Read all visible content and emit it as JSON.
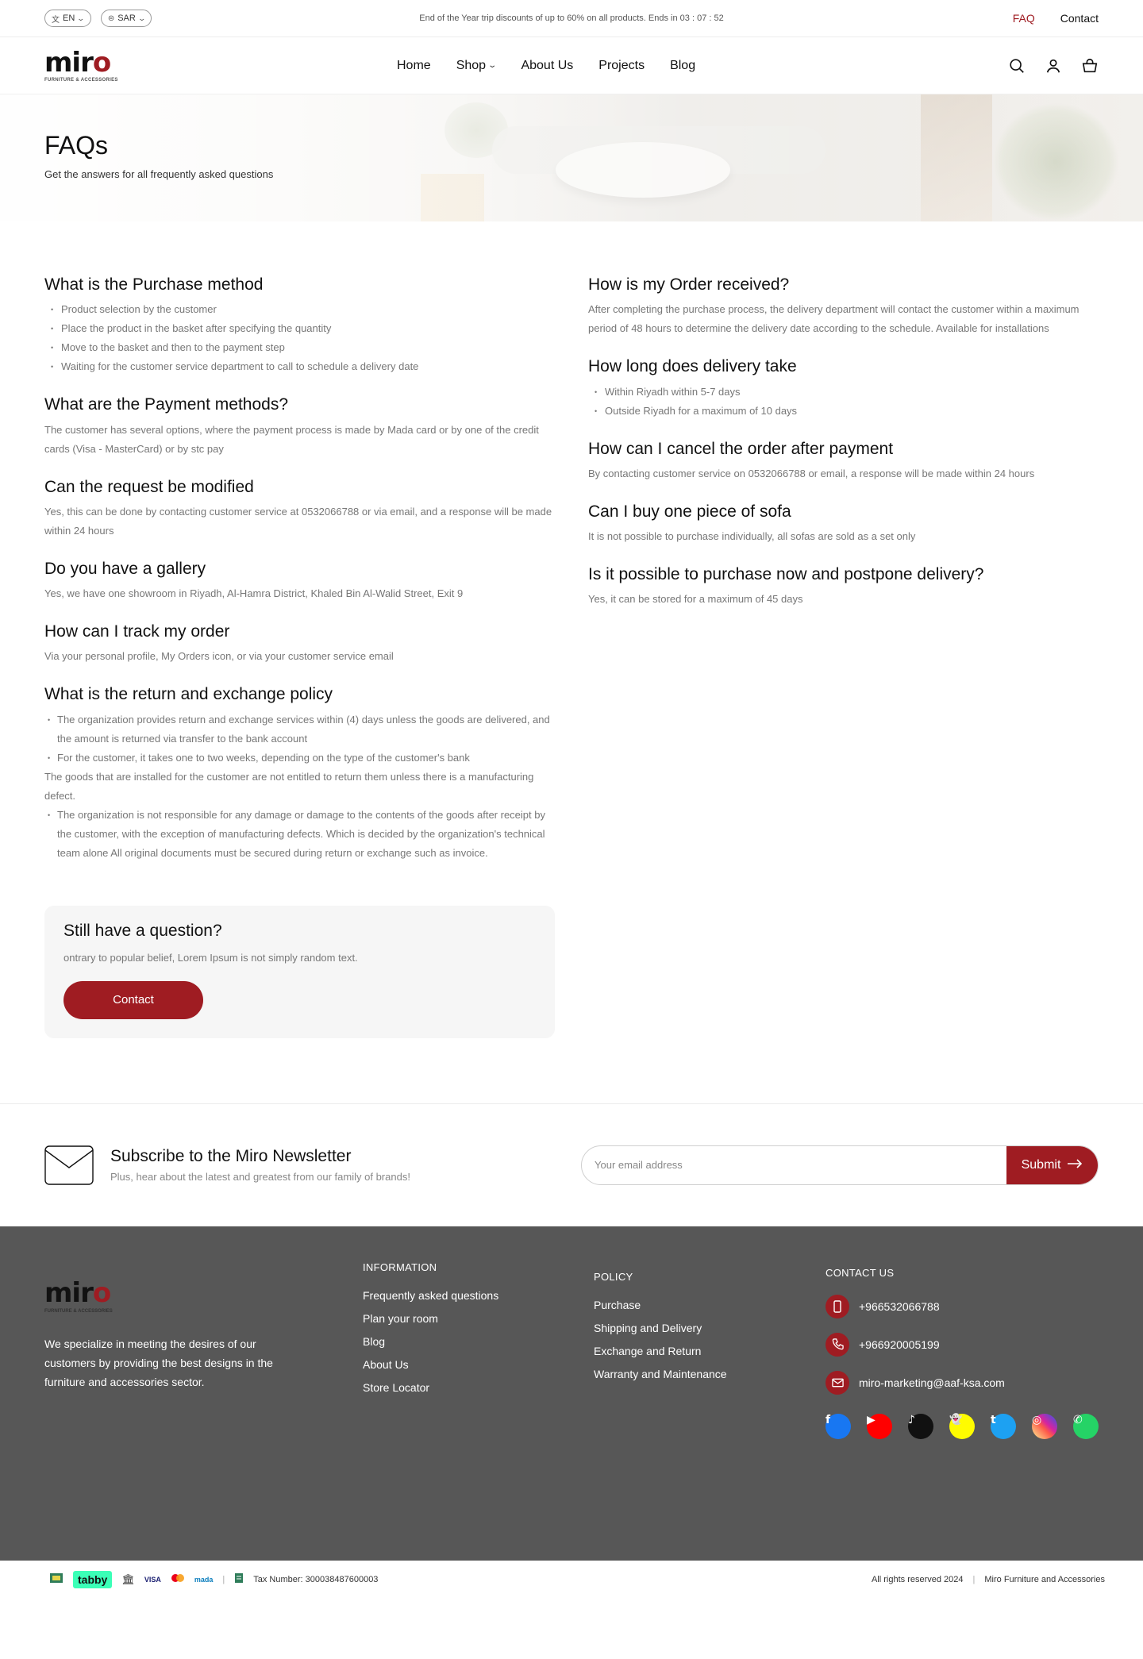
{
  "topbar": {
    "lang": "EN",
    "currency": "SAR",
    "promo": "End of the Year trip discounts of up to 60% on all products. Ends in 03 : 07 : 52",
    "links": {
      "faq": "FAQ",
      "contact": "Contact"
    }
  },
  "header": {
    "logo_word_main": "mir",
    "logo_word_accent": "o",
    "logo_tagline": "FURNITURE & ACCESSORIES",
    "nav": [
      "Home",
      "Shop",
      "About Us",
      "Projects",
      "Blog"
    ]
  },
  "hero": {
    "title": "FAQs",
    "subtitle": "Get the answers for all frequently asked questions"
  },
  "faq_left": [
    {
      "q": "What is the Purchase method",
      "bullets": [
        "Product selection by the customer",
        "Place the product in the basket after specifying the quantity",
        "Move to the basket and then to the payment step",
        "Waiting for the customer service department to call to schedule a delivery date"
      ]
    },
    {
      "q": "What are the Payment methods?",
      "a": "The customer has several options, where the payment process is made by Mada card or by one of the credit cards (Visa - MasterCard) or by stc pay"
    },
    {
      "q": "Can the request be modified",
      "a": "Yes, this can be done by contacting customer service at 0532066788 or via email, and a response will be made within 24 hours"
    },
    {
      "q": "Do you have a gallery",
      "a": "Yes, we have one showroom in Riyadh, Al-Hamra District, Khaled Bin Al-Walid Street, Exit 9"
    },
    {
      "q": "How can I track my order",
      "a": "Via your personal profile, My Orders icon, or via your customer service email"
    }
  ],
  "return_policy": {
    "q": "What is the return and exchange policy",
    "p1": "The organization provides return and exchange services within (4) days unless the goods are delivered, and the amount is returned via transfer to the bank account",
    "p2": "For the customer, it takes one to two weeks, depending on the type of the customer's bank",
    "p3": "The goods that are installed for the customer are not entitled to return them unless there is a manufacturing defect.",
    "p4": "The organization is not responsible for any damage or damage to the contents of the goods after receipt by the customer, with the exception of manufacturing defects. Which is decided by the organization's technical team alone All original documents must be secured during return or exchange such as invoice."
  },
  "faq_right": [
    {
      "q": "How is my Order received?",
      "a": "After completing the purchase process, the delivery department will contact the customer within a maximum period of 48 hours to determine the delivery date according to the schedule. Available for installations"
    },
    {
      "q": "How long does delivery take",
      "bullets": [
        "Within Riyadh within 5-7 days",
        "Outside Riyadh for a maximum of 10 days"
      ]
    },
    {
      "q": "How can I cancel the order after payment",
      "a": "By contacting customer service on 0532066788 or email, a response will be made within 24 hours"
    },
    {
      "q": "Can I buy one piece of sofa",
      "a": "It is not possible to purchase individually, all sofas are sold as a set only"
    },
    {
      "q": "Is it possible to purchase now and postpone delivery?",
      "a": "Yes, it can be stored for a maximum of 45 days"
    }
  ],
  "ask": {
    "title": "Still have a question?",
    "text": "ontrary to popular belief, Lorem Ipsum is not simply random text.",
    "button": "Contact"
  },
  "newsletter": {
    "title": "Subscribe to the Miro Newsletter",
    "subtitle": "Plus, hear about the latest and greatest from our family of brands!",
    "placeholder": "Your email address",
    "submit": "Submit"
  },
  "footer": {
    "about": "We specialize in meeting the desires of our customers by providing the best designs in the furniture and accessories sector.",
    "information": {
      "title": "INFORMATION",
      "links": [
        "Frequently asked questions",
        "Plan your room",
        "Blog",
        "About Us",
        "Store Locator"
      ]
    },
    "policy": {
      "title": "POLICY",
      "links": [
        "Purchase",
        "Shipping and Delivery",
        "Exchange and Return",
        "Warranty and Maintenance"
      ]
    },
    "contact": {
      "title": "CONTACT US",
      "phone1": "+966532066788",
      "phone2": "+966920005199",
      "email": "miro-marketing@aaf-ksa.com"
    },
    "socials": [
      {
        "name": "facebook-icon",
        "color": "#1877f2",
        "glyph": "f"
      },
      {
        "name": "youtube-icon",
        "color": "#ff0000",
        "glyph": "▶"
      },
      {
        "name": "tiktok-icon",
        "color": "#111111",
        "glyph": "♪"
      },
      {
        "name": "snapchat-icon",
        "color": "#fffc00",
        "glyph": "👻"
      },
      {
        "name": "twitter-icon",
        "color": "#1da1f2",
        "glyph": "t"
      },
      {
        "name": "instagram-icon",
        "color": "#d6249f",
        "glyph": "◎"
      },
      {
        "name": "whatsapp-icon",
        "color": "#25d366",
        "glyph": "✆"
      }
    ]
  },
  "bottom": {
    "tabby": "tabby",
    "visa": "VISA",
    "mada": "mada",
    "tax": "Tax Number: 300038487600003",
    "rights": "All rights reserved 2024",
    "company": "Miro Furniture and Accessories"
  },
  "colors": {
    "accent": "#9f1c22",
    "footer_bg": "#575757"
  }
}
